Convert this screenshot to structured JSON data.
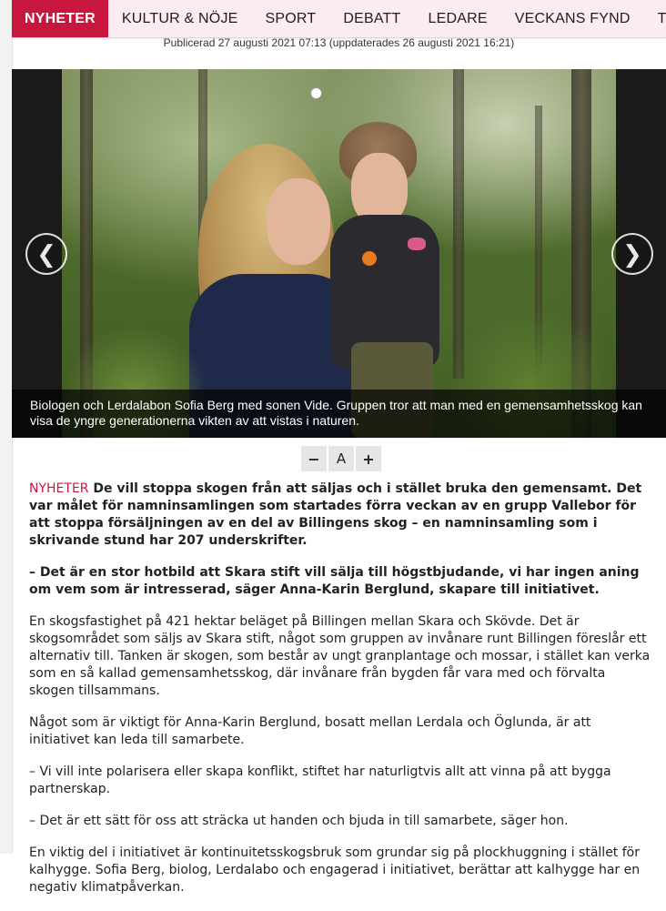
{
  "nav": {
    "items": [
      {
        "label": "NYHETER",
        "active": true
      },
      {
        "label": "KULTUR & NÖJE",
        "active": false
      },
      {
        "label": "SPORT",
        "active": false
      },
      {
        "label": "DEBATT",
        "active": false
      },
      {
        "label": "LEDARE",
        "active": false
      },
      {
        "label": "VECKANS FYND",
        "active": false
      },
      {
        "label": "TÄVLI",
        "active": false
      }
    ],
    "accent_color": "#c8173f"
  },
  "article": {
    "published": "Publicerad 27 augusti 2021 07:13 (uppdaterades 26 augusti 2021 16:21)",
    "slideshow": {
      "caption": "Biologen och Lerdalabon Sofia Berg med sonen Vide. Gruppen tror att man med en gemensamhetsskog kan visa de yngre generationerna vikten av att vistas i naturen.",
      "prev_icon": "chevron-left-icon",
      "next_icon": "chevron-right-icon",
      "prev_glyph": "❮",
      "next_glyph": "❯"
    },
    "font_controls": {
      "decrease": "−",
      "reset": "A",
      "increase": "+"
    },
    "kicker": "NYHETER",
    "lead": " De vill stoppa skogen från att säljas och i stället bruka den gemensamt. Det var målet för namninsamlingen som startades förra veckan av en grupp Vallebor för att stoppa försäljningen av en del av Billingens skog – en namninsamling som i skrivande stund har 207 underskrifter.",
    "lead2": "– Det är en stor hotbild att Skara stift vill sälja till högstbjudande, vi har ingen aning om vem som är intresserad, säger Anna-Karin Berglund, skapare till initiativet.",
    "paragraphs": [
      "En skogsfastighet på 421 hektar beläget på Billingen mellan Skara och Skövde. Det är skogsområdet som säljs av Skara stift, något som gruppen av invånare runt Billingen föreslår ett alternativ till. Tanken är skogen, som består av ungt granplantage och mossar, i stället kan verka som en så kallad gemensamhetsskog, där invånare från bygden får vara med och förvalta skogen tillsammans.",
      "Något som är viktigt för Anna-Karin Berglund, bosatt mellan Lerdala och Öglunda, är att initiativet kan leda till samarbete.",
      "– Vi vill inte polarisera eller skapa konflikt, stiftet har naturligtvis allt att vinna på att bygga partnerskap.",
      "– Det är ett sätt för oss att sträcka ut handen och bjuda in till samarbete, säger hon.",
      "En viktig del i initiativet är kontinuitetsskogsbruk som grundar sig på plockhuggning i stället för kalhygge. Sofia Berg, biolog, Lerdalabo och engagerad i initiativet, berättar att kalhygge har en negativ klimatpåverkan."
    ]
  }
}
